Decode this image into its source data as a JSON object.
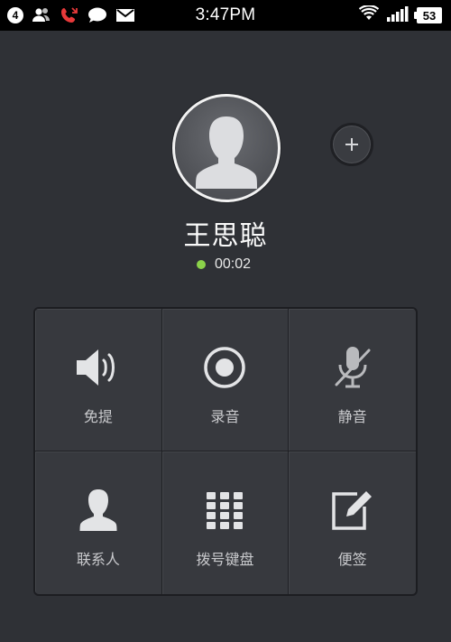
{
  "status_bar": {
    "notification_count": "4",
    "time": "3:47PM",
    "battery": "53",
    "icons": [
      "contacts-icon",
      "missed-call-icon",
      "message-icon",
      "mail-icon",
      "wifi-icon",
      "signal-icon",
      "battery-icon"
    ]
  },
  "caller": {
    "name": "王思聪",
    "duration": "00:02",
    "status_color": "#8bd24a"
  },
  "controls": [
    {
      "label": "免提",
      "icon": "speaker-icon"
    },
    {
      "label": "录音",
      "icon": "record-icon"
    },
    {
      "label": "静音",
      "icon": "mute-icon"
    },
    {
      "label": "联系人",
      "icon": "contact-icon"
    },
    {
      "label": "拨号键盘",
      "icon": "dialpad-icon"
    },
    {
      "label": "便签",
      "icon": "note-icon"
    }
  ]
}
